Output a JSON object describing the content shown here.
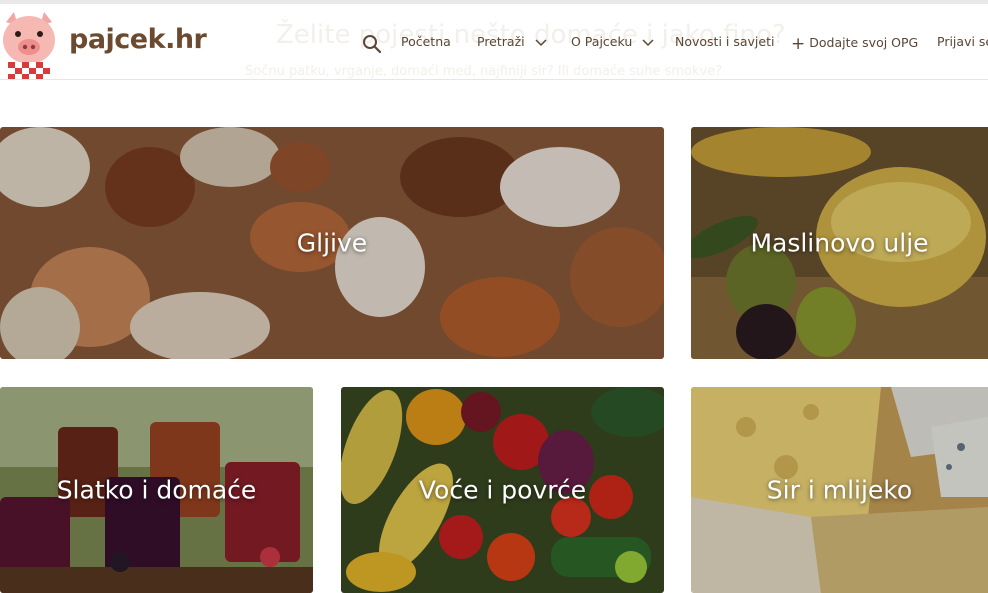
{
  "header": {
    "brand": "pajcek.hr",
    "ghost_title": "Želite pojesti nešto domaće i jako fino?",
    "ghost_subtitle": "Sočnu patku, vrganje, domaći med, najfiniji sir? Ili domaće suhe smokve?",
    "nav": {
      "home": "Početna",
      "search_menu": "Pretraži",
      "about": "O Pajceku",
      "news": "Novosti i savjeti",
      "add_opg": "Dodajte svoj OPG",
      "login": "Prijavi se"
    }
  },
  "categories": [
    {
      "label": "Gljive",
      "icon": "mushrooms-image"
    },
    {
      "label": "Maslinovo ulje",
      "icon": "olive-oil-image"
    },
    {
      "label": "Slatko i domaće",
      "icon": "jam-jars-image"
    },
    {
      "label": "Voće i povrće",
      "icon": "fruit-vegetables-image"
    },
    {
      "label": "Sir i mlijeko",
      "icon": "cheese-image"
    }
  ]
}
